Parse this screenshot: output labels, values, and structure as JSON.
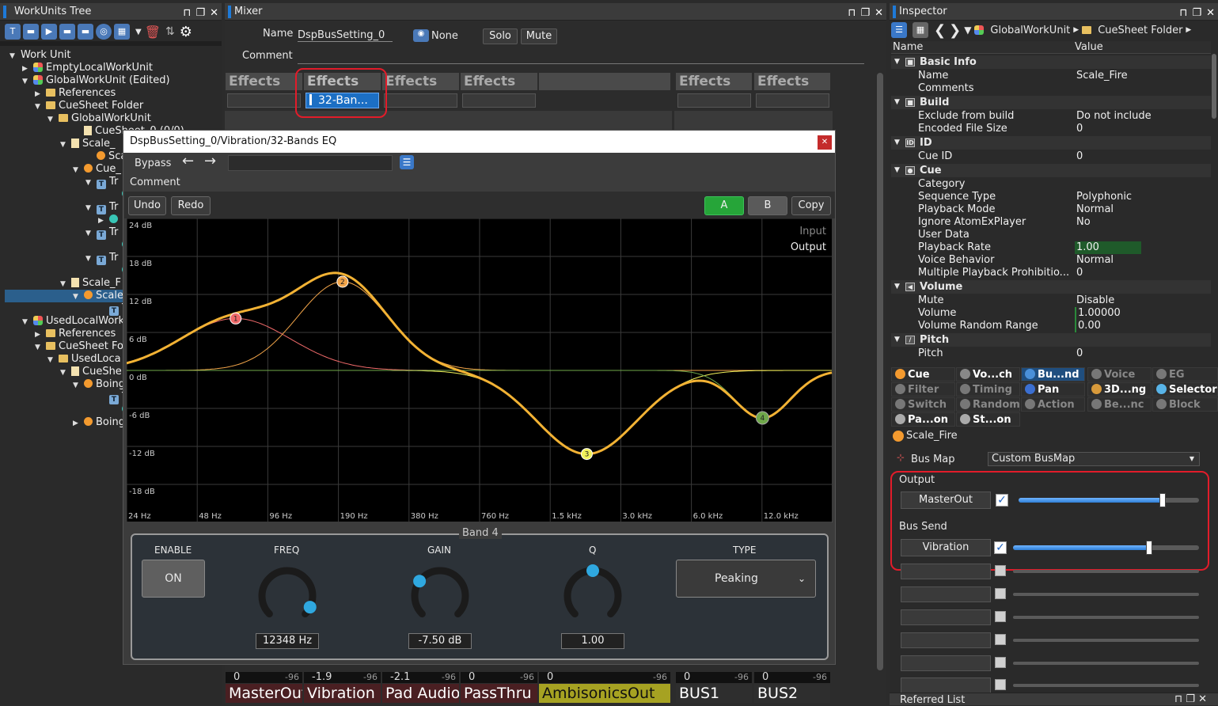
{
  "workunits": {
    "title": "WorkUnits Tree",
    "rows": [
      {
        "label": "Work Unit",
        "icon": "none",
        "tri": "▼"
      },
      {
        "label": "EmptyLocalWorkUnit",
        "icon": "cube",
        "tri": "▶"
      },
      {
        "label": "GlobalWorkUnit (Edited)",
        "icon": "cube",
        "tri": "▼"
      },
      {
        "label": "References",
        "icon": "folder",
        "tri": "▶"
      },
      {
        "label": "CueSheet Folder",
        "icon": "folder",
        "tri": "▼"
      },
      {
        "label": "GlobalWorkUnit",
        "icon": "folder",
        "tri": "▼"
      },
      {
        "label": "CueSheet_0 (0/0)",
        "icon": "doc",
        "tri": ""
      },
      {
        "label": "Scale_",
        "icon": "doc",
        "tri": "▼"
      },
      {
        "label": "Scale",
        "icon": "dot",
        "tri": ""
      },
      {
        "label": "Cue_",
        "icon": "dot",
        "tri": "▼"
      },
      {
        "label": "Tr",
        "icon": "t",
        "tri": "▼"
      },
      {
        "label": "",
        "icon": "teal",
        "tri": ""
      },
      {
        "label": "Tr",
        "icon": "t",
        "tri": "▼"
      },
      {
        "label": "",
        "icon": "teal",
        "tri": "▶"
      },
      {
        "label": "Tr",
        "icon": "t",
        "tri": "▼"
      },
      {
        "label": "",
        "icon": "teal",
        "tri": ""
      },
      {
        "label": "Tr",
        "icon": "t",
        "tri": "▼"
      },
      {
        "label": "",
        "icon": "teal",
        "tri": ""
      },
      {
        "label": "Scale_F",
        "icon": "doc",
        "tri": "▼"
      },
      {
        "label": "Scale",
        "icon": "dot",
        "tri": "▼"
      },
      {
        "label": "Tr",
        "icon": "t",
        "tri": ""
      },
      {
        "label": "UsedLocalWork",
        "icon": "cube",
        "tri": "▼"
      },
      {
        "label": "References",
        "icon": "folder",
        "tri": "▶"
      },
      {
        "label": "CueSheet Fo",
        "icon": "folder",
        "tri": "▼"
      },
      {
        "label": "UsedLoca",
        "icon": "folder",
        "tri": "▼"
      },
      {
        "label": "CueShe",
        "icon": "doc",
        "tri": "▼"
      },
      {
        "label": "Boing",
        "icon": "dot",
        "tri": "▼"
      },
      {
        "label": "Tr",
        "icon": "t",
        "tri": ""
      },
      {
        "label": "",
        "icon": "teal",
        "tri": ""
      },
      {
        "label": "Boing",
        "icon": "dot",
        "tri": "▶"
      }
    ]
  },
  "mixer": {
    "title": "Mixer",
    "name_label": "Name",
    "name_value": "DspBusSetting_0",
    "snapshot_label": "None",
    "solo": "Solo",
    "mute": "Mute",
    "comment_label": "Comment",
    "effects_label": "Effects",
    "effect_slot": "32-Ban...",
    "strips": [
      {
        "name": "MasterOut",
        "level": "0",
        "min": "-96"
      },
      {
        "name": "Vibration",
        "level": "-1.9",
        "min": "-96"
      },
      {
        "name": "Pad Audio",
        "level": "-2.1",
        "min": "-96"
      },
      {
        "name": "PassThru",
        "level": "0",
        "min": "-96"
      },
      {
        "name": "AmbisonicsOut",
        "level": "0",
        "min": "-96"
      },
      {
        "name": "BUS1",
        "level": "0",
        "min": "-96"
      },
      {
        "name": "BUS2",
        "level": "0",
        "min": "-96"
      }
    ]
  },
  "eq_dialog": {
    "title": "DspBusSetting_0/Vibration/32-Bands EQ",
    "bypass": "Bypass",
    "comment": "Comment",
    "undo": "Undo",
    "redo": "Redo",
    "a": "A",
    "b": "B",
    "copy": "Copy",
    "legend_input": "Input",
    "legend_output": "Output",
    "y_ticks": [
      "24 dB",
      "18 dB",
      "12 dB",
      "6 dB",
      "0 dB",
      "-6 dB",
      "-12 dB",
      "-18 dB"
    ],
    "x_ticks": [
      "24 Hz",
      "48 Hz",
      "96 Hz",
      "190 Hz",
      "380 Hz",
      "760 Hz",
      "1.5 kHz",
      "3.0 kHz",
      "6.0 kHz",
      "12.0 kHz"
    ],
    "band_title": "Band 4",
    "enable_label": "ENABLE",
    "enable_value": "ON",
    "freq_label": "FREQ",
    "freq_value": "12348 Hz",
    "gain_label": "GAIN",
    "gain_value": "-7.50 dB",
    "q_label": "Q",
    "q_value": "1.00",
    "type_label": "TYPE",
    "type_value": "Peaking",
    "knob_levels": {
      "freq": 0.93,
      "gain": 0.3,
      "q": 0.5
    },
    "bands": [
      {
        "id": "1",
        "freq_hz": 70,
        "gain_db": 8.2,
        "color": "#f06a6a"
      },
      {
        "id": "2",
        "freq_hz": 200,
        "gain_db": 14.0,
        "color": "#f4a64a"
      },
      {
        "id": "3",
        "freq_hz": 2200,
        "gain_db": -13.2,
        "color": "#f2f25a"
      },
      {
        "id": "4",
        "freq_hz": 12348,
        "gain_db": -7.5,
        "color": "#6fa84a"
      }
    ]
  },
  "inspector": {
    "title": "Inspector",
    "breadcrumb_1": "GlobalWorkUnit",
    "breadcrumb_2": "CueSheet Folder",
    "col_name": "Name",
    "col_value": "Value",
    "sections": {
      "basic": "Basic Info",
      "build": "Build",
      "id": "ID",
      "cue": "Cue",
      "volume": "Volume",
      "pitch": "Pitch"
    },
    "rows": {
      "name": [
        "Name",
        "Scale_Fire"
      ],
      "comments": [
        "Comments",
        ""
      ],
      "exclude": [
        "Exclude from build",
        "Do not include"
      ],
      "encoded": [
        "Encoded File Size",
        "0"
      ],
      "cueid": [
        "Cue ID",
        "0"
      ],
      "category": [
        "Category",
        ""
      ],
      "seqtype": [
        "Sequence Type",
        "Polyphonic"
      ],
      "playmode": [
        "Playback Mode",
        "Normal"
      ],
      "ignore": [
        "Ignore AtomExPlayer",
        "No"
      ],
      "userdata": [
        "User Data",
        ""
      ],
      "rate": [
        "Playback Rate",
        "1.00"
      ],
      "voice": [
        "Voice Behavior",
        "Normal"
      ],
      "multi": [
        "Multiple Playback Prohibitio...",
        "0"
      ],
      "mute": [
        "Mute",
        "Disable"
      ],
      "volume": [
        "Volume",
        "1.00000"
      ],
      "volrand": [
        "Volume Random Range",
        "0.00"
      ],
      "pitch": [
        "Pitch",
        "0"
      ]
    },
    "tabs": [
      {
        "label": "Cue",
        "color": "#f39a2f",
        "dim": false
      },
      {
        "label": "Vo...ch",
        "color": "#888",
        "dim": false
      },
      {
        "label": "Bu...nd",
        "color": "#4a90d9",
        "dim": false
      },
      {
        "label": "Voice",
        "color": "#777",
        "dim": true
      },
      {
        "label": "EG",
        "color": "#777",
        "dim": true
      },
      {
        "label": "Filter",
        "color": "#777",
        "dim": true
      },
      {
        "label": "Timing",
        "color": "#777",
        "dim": true
      },
      {
        "label": "Pan",
        "color": "#3b6fd1",
        "dim": false
      },
      {
        "label": "3D...ng",
        "color": "#d89a3b",
        "dim": false
      },
      {
        "label": "Selector",
        "color": "#58b4e8",
        "dim": false
      },
      {
        "label": "Switch",
        "color": "#777",
        "dim": true
      },
      {
        "label": "Random",
        "color": "#777",
        "dim": true
      },
      {
        "label": "Action",
        "color": "#777",
        "dim": true
      },
      {
        "label": "Be...nc",
        "color": "#777",
        "dim": true
      },
      {
        "label": "Block",
        "color": "#777",
        "dim": true
      },
      {
        "label": "Pa...on",
        "color": "#aaa",
        "dim": false
      },
      {
        "label": "St...on",
        "color": "#aaa",
        "dim": false
      }
    ],
    "object_name": "Scale_Fire",
    "busmap_label": "Bus Map",
    "busmap_value": "Custom BusMap",
    "output_label": "Output",
    "output_bus": "MasterOut",
    "output_level": 0.8,
    "bussend_label": "Bus Send",
    "send_bus": "Vibration",
    "send_level": 0.73,
    "referred_list": "Referred List"
  }
}
